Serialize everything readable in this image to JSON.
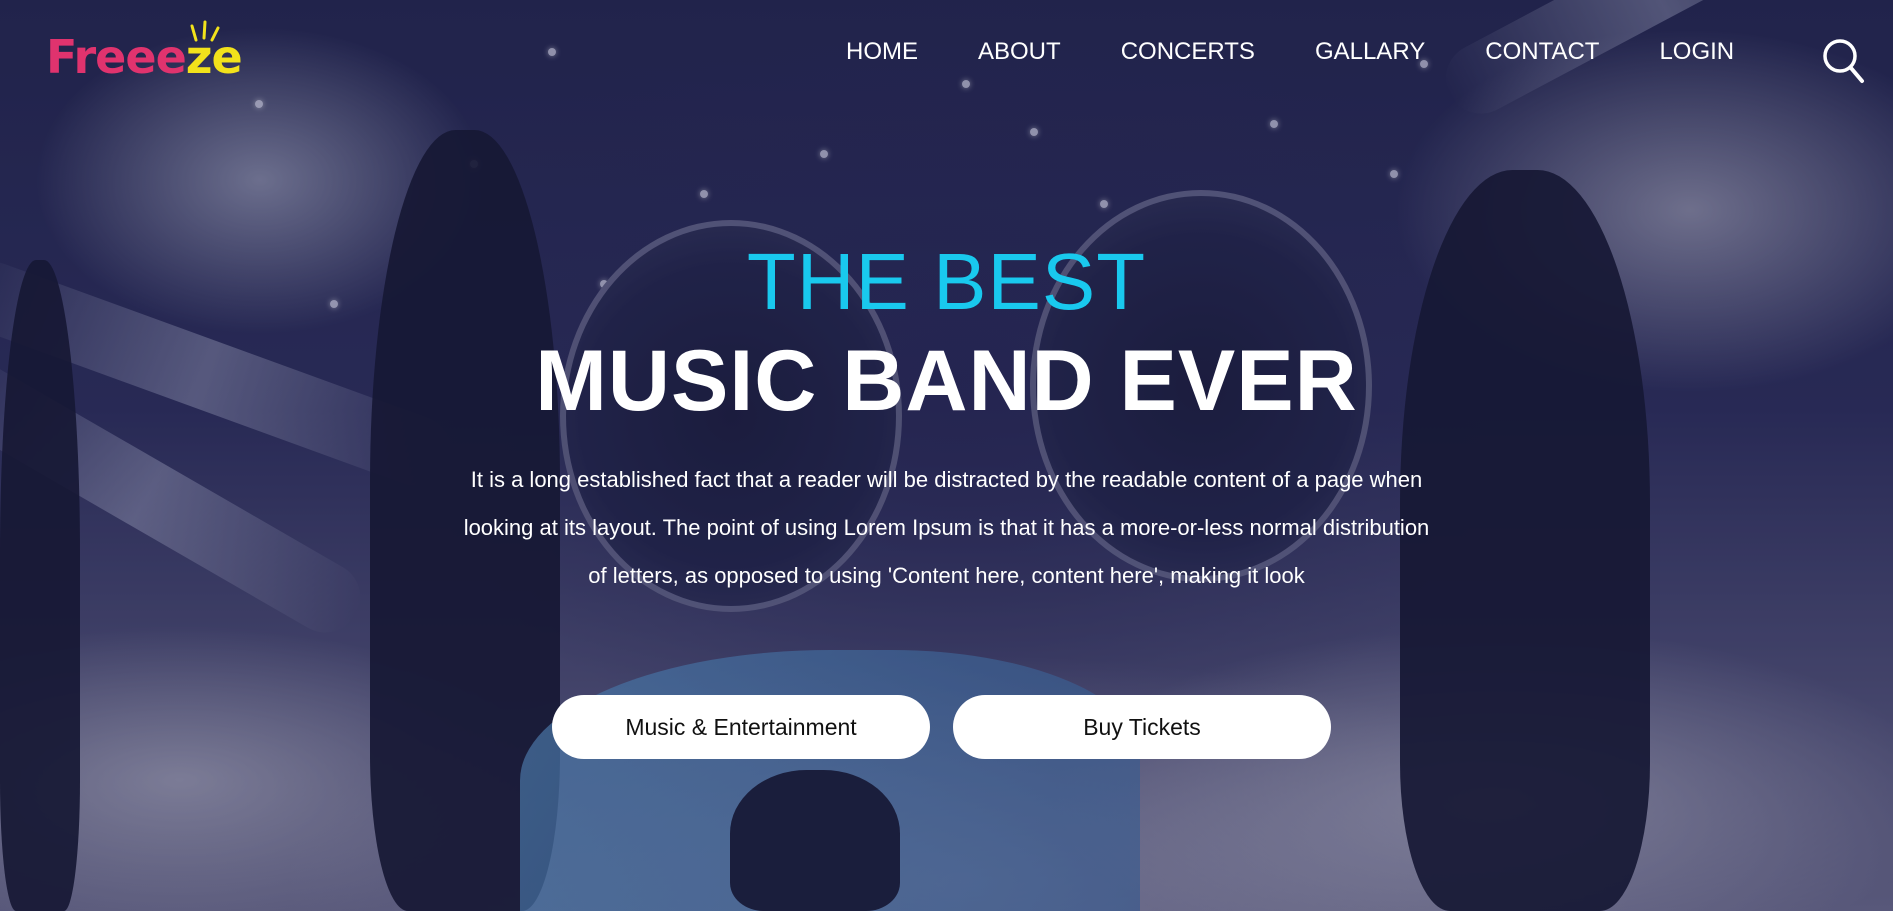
{
  "logo": {
    "text_main": "Freee",
    "text_accent": "ze",
    "color_main": "#e0336e",
    "color_accent": "#f2e21b"
  },
  "nav": {
    "items": [
      {
        "label": "HOME"
      },
      {
        "label": "ABOUT"
      },
      {
        "label": "CONCERTS"
      },
      {
        "label": "GALLARY"
      },
      {
        "label": "CONTACT"
      },
      {
        "label": "LOGIN"
      }
    ],
    "search_icon": "search-icon"
  },
  "hero": {
    "headline_top": "THE BEST",
    "headline_main": "MUSIC BAND EVER",
    "description": "It is a long established fact that a reader will be distracted by the readable content of a page when looking at its layout. The point of using Lorem Ipsum is that it has a more-or-less normal distribution of letters, as opposed to using 'Content here, content here', making it look",
    "accent_color": "#19c9ee",
    "buttons": {
      "primary_label": "Music & Entertainment",
      "secondary_label": "Buy Tickets"
    }
  }
}
